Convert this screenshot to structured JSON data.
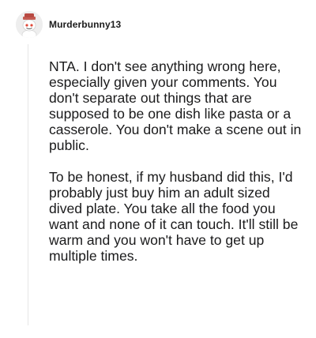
{
  "comment": {
    "username": "Murderbunny13",
    "avatar_icon": "snoo-avatar-icon",
    "paragraphs": [
      "NTA. I don't see anything wrong here, especially given your comments. You don't separate out things that are supposed to be one dish like pasta or a casserole. You don't make a scene out in public.",
      "To be honest, if my husband did this, I'd probably just buy him an adult sized dived plate. You take all the food you want and none of it can touch. It'll still be warm and you won't have to get up multiple times."
    ]
  }
}
